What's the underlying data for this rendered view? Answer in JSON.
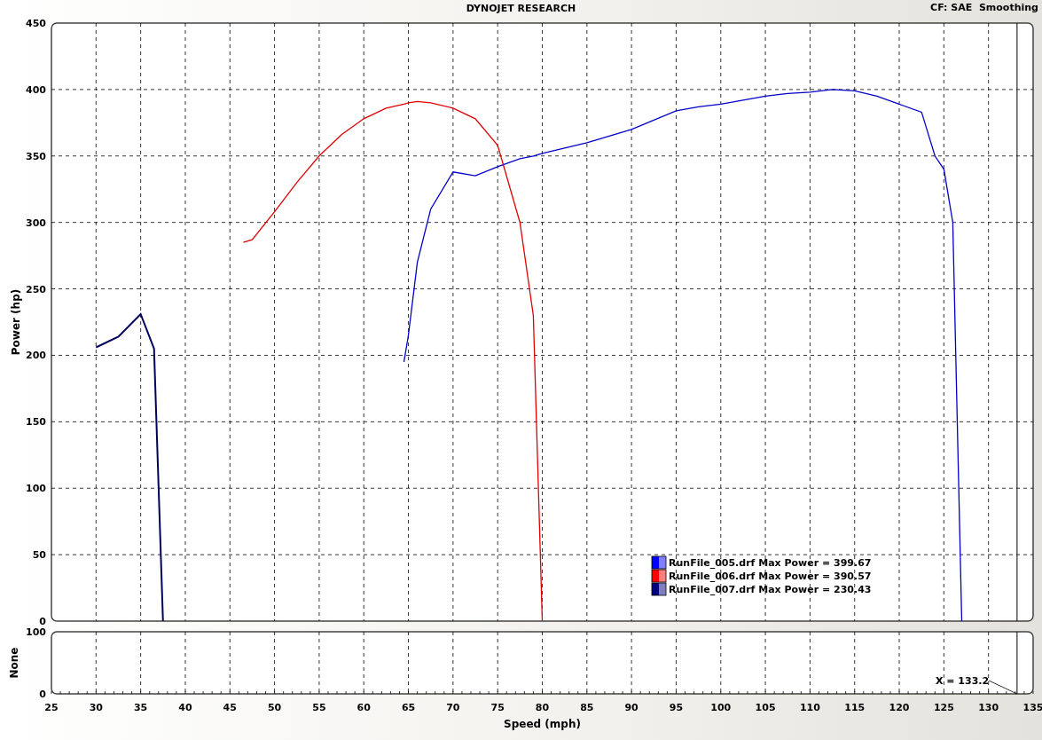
{
  "header": {
    "title": "DYNOJET RESEARCH",
    "correction": "CF: SAE  Smoothing"
  },
  "power_chart": {
    "chart_data": {
      "type": "line",
      "ylabel": "Power (hp)",
      "xlim": [
        25,
        135
      ],
      "ylim": [
        0,
        450
      ],
      "grid": true,
      "yticks": [
        0,
        50,
        100,
        150,
        200,
        250,
        300,
        350,
        400,
        450
      ],
      "ref_lines": [
        {
          "axis": "x",
          "value": 133.2
        }
      ],
      "x": [
        30,
        32.5,
        35,
        36.5,
        37.5,
        46.5,
        47.5,
        50,
        52.5,
        55,
        57.5,
        60,
        62.5,
        64.5,
        65,
        66,
        67.5,
        70,
        72.5,
        75,
        77.5,
        79,
        80,
        82.5,
        85,
        87.5,
        90,
        92.5,
        95,
        97.5,
        100,
        102.5,
        105,
        107.5,
        110,
        112.5,
        115,
        117.5,
        120,
        122.5,
        124,
        125,
        126,
        127
      ],
      "series": [
        {
          "name": "RunFile_005.drf",
          "color": "#0000c8",
          "values": [
            null,
            null,
            null,
            null,
            null,
            null,
            null,
            null,
            null,
            null,
            null,
            null,
            null,
            195,
            215,
            270,
            310,
            338,
            335,
            342,
            348,
            350,
            352,
            356,
            360,
            365,
            370,
            377,
            384,
            387,
            389,
            392,
            395,
            397,
            398,
            400,
            399,
            395,
            389,
            383,
            350,
            340,
            300,
            0
          ]
        },
        {
          "name": "RunFile_006.drf",
          "color": "#e00000",
          "values": [
            null,
            null,
            null,
            null,
            null,
            285,
            287,
            308,
            330,
            350,
            366,
            378,
            386,
            389,
            390,
            391,
            390,
            386,
            378,
            358,
            300,
            230,
            0,
            null,
            null,
            null,
            null,
            null,
            null,
            null,
            null,
            null,
            null,
            null,
            null,
            null,
            null,
            null,
            null,
            null,
            null,
            null,
            null,
            null
          ]
        },
        {
          "name": "RunFile_007.drf",
          "color": "#00005a",
          "values": [
            206,
            214,
            231,
            205,
            0,
            null,
            null,
            null,
            null,
            null,
            null,
            null,
            null,
            null,
            null,
            null,
            null,
            null,
            null,
            null,
            null,
            null,
            null,
            null,
            null,
            null,
            null,
            null,
            null,
            null,
            null,
            null,
            null,
            null,
            null,
            null,
            null,
            null,
            null,
            null,
            null,
            null,
            null,
            null
          ]
        }
      ]
    },
    "legend": [
      {
        "text": "Max Power = 399.67",
        "color": "#0000ff"
      },
      {
        "text": "Max Power = 390.57",
        "color": "#ff0000"
      },
      {
        "text": "Max Power = 230.43",
        "color": "#000080"
      }
    ]
  },
  "lower_chart": {
    "chart_data": {
      "type": "line",
      "xlabel": "Speed (mph)",
      "ylabel": "None",
      "xlim": [
        25,
        135
      ],
      "ylim": [
        0,
        100
      ],
      "grid": true,
      "xticks": [
        25,
        30,
        35,
        40,
        45,
        50,
        55,
        60,
        65,
        70,
        75,
        80,
        85,
        90,
        95,
        100,
        105,
        110,
        115,
        120,
        125,
        130,
        135
      ],
      "yticks": [
        0,
        100
      ],
      "ref_lines": [
        {
          "axis": "x",
          "value": 133.2
        }
      ],
      "annotations": [
        "X = 133.2"
      ]
    }
  }
}
